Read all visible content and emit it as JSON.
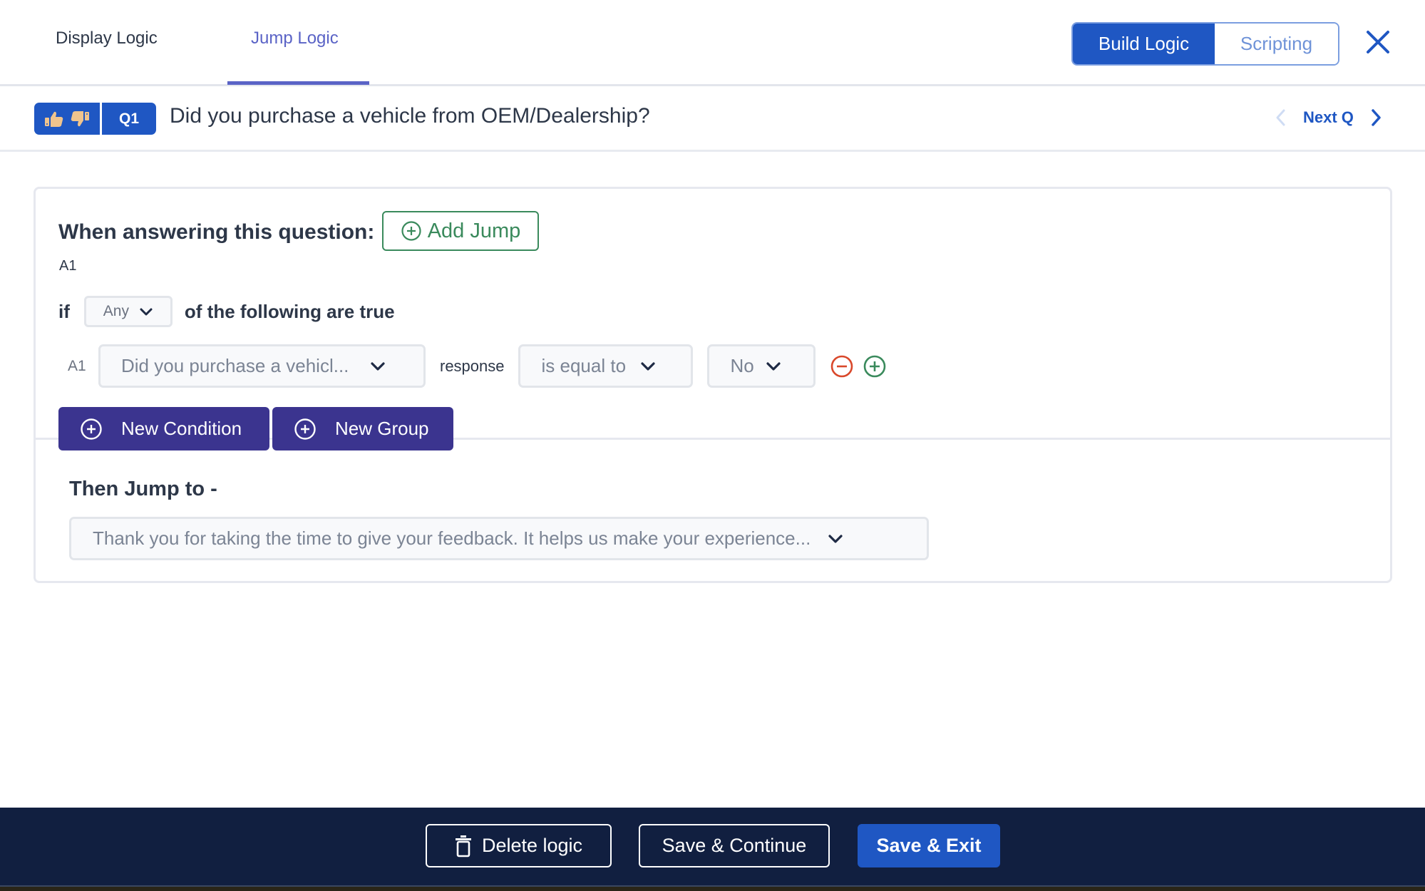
{
  "header": {
    "tabs": [
      {
        "label": "Display Logic",
        "active": false
      },
      {
        "label": "Jump Logic",
        "active": true
      }
    ],
    "mode_toggle": {
      "options": [
        "Build Logic",
        "Scripting"
      ],
      "selected": "Build Logic"
    },
    "close_icon": "close-icon",
    "colors": {
      "accent": "#1f57c3",
      "tab_active": "#5a63c6"
    }
  },
  "question_bar": {
    "type_icon": "thumbs-up-down-icon",
    "number": "Q1",
    "text": "Did you purchase a vehicle from OEM/Dealership?",
    "nav": {
      "prev_icon": "chevron-left-icon",
      "next_label": "Next Q",
      "next_icon": "chevron-right-icon"
    }
  },
  "logic_card": {
    "when_label": "When answering this question:",
    "add_jump_label": "Add Jump",
    "answer_label": "A1",
    "if_label": "if",
    "match_select": {
      "value": "Any"
    },
    "of_label": "of the following are true",
    "condition": {
      "id_label": "A1",
      "question_select": {
        "value": "Did you purchase a vehicl..."
      },
      "response_label": "response",
      "operator_select": {
        "value": "is equal to"
      },
      "value_select": {
        "value": "No"
      },
      "remove_icon": "minus-circle-icon",
      "add_icon": "plus-circle-icon"
    },
    "new_condition_label": "New Condition",
    "new_group_label": "New Group",
    "then_label": "Then Jump to -",
    "target_select": {
      "value": "Thank you for taking the time to give your feedback. It helps us make your experience..."
    },
    "colors": {
      "add_jump": "#3a8a5c",
      "remove": "#d9482b",
      "buttons": "#3b348f"
    }
  },
  "footer": {
    "delete_label": "Delete logic",
    "save_continue_label": "Save & Continue",
    "save_exit_label": "Save & Exit",
    "colors": {
      "background": "#111f40",
      "primary": "#1f57c3"
    }
  }
}
